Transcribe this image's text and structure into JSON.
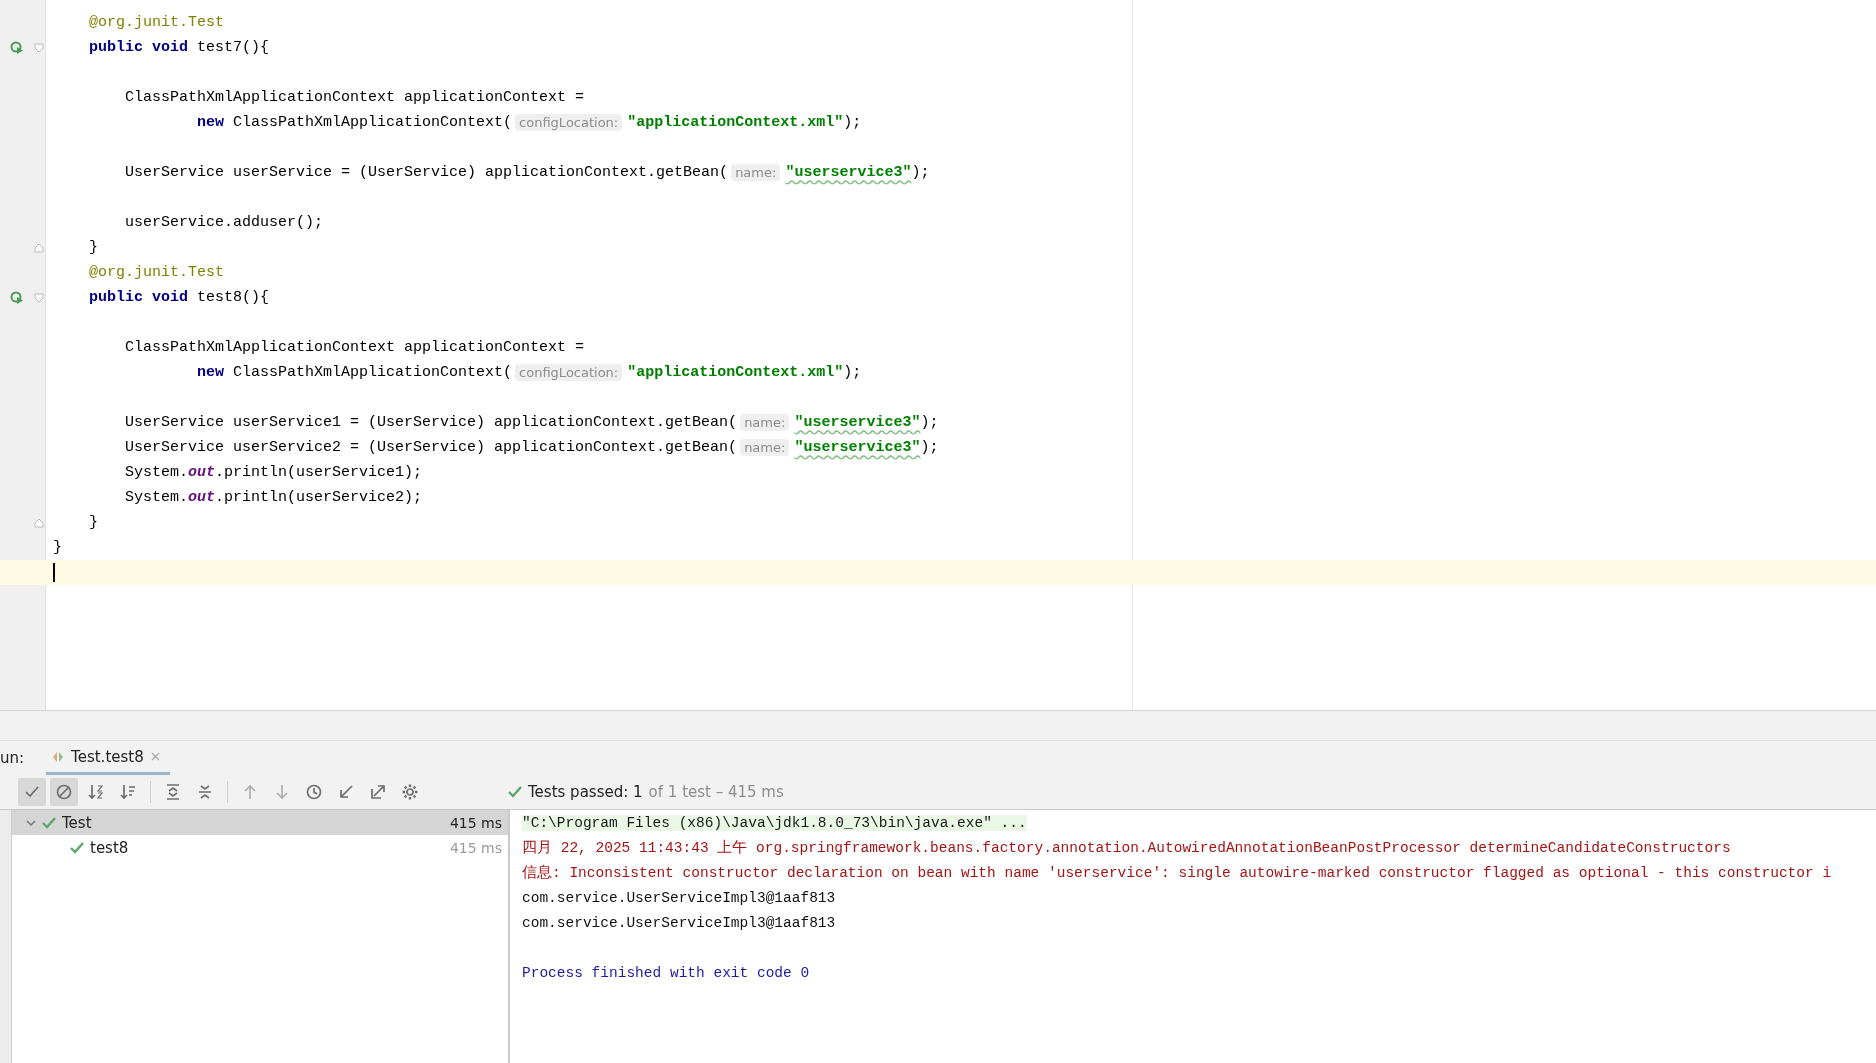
{
  "editor": {
    "lines": [
      {
        "current": false,
        "tokens": [
          {
            "kind": "annotation",
            "text": "    @org.junit."
          },
          {
            "kind": "annotation-name",
            "text": "Test"
          }
        ]
      },
      {
        "current": false,
        "run": true,
        "fold_start": true,
        "tokens": [
          {
            "kind": "keyword",
            "text": "    public void "
          },
          {
            "kind": "plain",
            "text": "test7(){"
          }
        ]
      },
      {
        "current": false
      },
      {
        "current": false,
        "tokens": [
          {
            "kind": "plain",
            "text": "        ClassPathXmlApplicationContext applicationContext ="
          }
        ]
      },
      {
        "current": false,
        "tokens": [
          {
            "kind": "keyword",
            "text": "                new "
          },
          {
            "kind": "plain",
            "text": "ClassPathXmlApplicationContext("
          },
          {
            "kind": "hint",
            "text": "configLocation:"
          },
          {
            "kind": "string",
            "text": "\"applicationContext.xml\""
          },
          {
            "kind": "plain",
            "text": ");"
          }
        ]
      },
      {
        "current": false
      },
      {
        "current": false,
        "tokens": [
          {
            "kind": "plain",
            "text": "        UserService userService = (UserService) applicationContext.getBean("
          },
          {
            "kind": "hint",
            "text": "name:"
          },
          {
            "kind": "string",
            "text": "\"userservice3\"",
            "underlined": true
          },
          {
            "kind": "plain",
            "text": ");"
          }
        ]
      },
      {
        "current": false
      },
      {
        "current": false,
        "tokens": [
          {
            "kind": "plain",
            "text": "        userService.adduser();"
          }
        ]
      },
      {
        "current": false,
        "fold_end": true,
        "tokens": [
          {
            "kind": "plain",
            "text": "    }"
          }
        ]
      },
      {
        "current": false,
        "tokens": [
          {
            "kind": "annotation",
            "text": "    @org.junit."
          },
          {
            "kind": "annotation-name",
            "text": "Test"
          }
        ]
      },
      {
        "current": false,
        "run": true,
        "fold_start": true,
        "tokens": [
          {
            "kind": "keyword",
            "text": "    public void "
          },
          {
            "kind": "plain",
            "text": "test8(){"
          }
        ]
      },
      {
        "current": false
      },
      {
        "current": false,
        "tokens": [
          {
            "kind": "plain",
            "text": "        ClassPathXmlApplicationContext applicationContext ="
          }
        ]
      },
      {
        "current": false,
        "tokens": [
          {
            "kind": "keyword",
            "text": "                new "
          },
          {
            "kind": "plain",
            "text": "ClassPathXmlApplicationContext("
          },
          {
            "kind": "hint",
            "text": "configLocation:"
          },
          {
            "kind": "string",
            "text": "\"applicationContext.xml\""
          },
          {
            "kind": "plain",
            "text": ");"
          }
        ]
      },
      {
        "current": false
      },
      {
        "current": false,
        "tokens": [
          {
            "kind": "plain",
            "text": "        UserService userService1 = (UserService) applicationContext.getBean("
          },
          {
            "kind": "hint",
            "text": "name:"
          },
          {
            "kind": "string",
            "text": "\"userservice3\"",
            "underlined": true
          },
          {
            "kind": "plain",
            "text": ");"
          }
        ]
      },
      {
        "current": false,
        "tokens": [
          {
            "kind": "plain",
            "text": "        UserService userService2 = (UserService) applicationContext.getBean("
          },
          {
            "kind": "hint",
            "text": "name:"
          },
          {
            "kind": "string",
            "text": "\"userservice3\"",
            "underlined": true
          },
          {
            "kind": "plain",
            "text": ");"
          }
        ]
      },
      {
        "current": false,
        "tokens": [
          {
            "kind": "plain",
            "text": "        System."
          },
          {
            "kind": "field",
            "text": "out"
          },
          {
            "kind": "plain",
            "text": ".println(userService1);"
          }
        ]
      },
      {
        "current": false,
        "tokens": [
          {
            "kind": "plain",
            "text": "        System."
          },
          {
            "kind": "field",
            "text": "out"
          },
          {
            "kind": "plain",
            "text": ".println(userService2);"
          }
        ]
      },
      {
        "current": false,
        "fold_end": true,
        "tokens": [
          {
            "kind": "plain",
            "text": "    }"
          }
        ]
      },
      {
        "current": false,
        "tokens": [
          {
            "kind": "plain",
            "text": "}"
          }
        ]
      },
      {
        "current": true
      }
    ]
  },
  "run_panel": {
    "label": "un:",
    "tabs": [
      {
        "label": "Test.test8",
        "selected": true
      }
    ],
    "toolbar": [
      {
        "kind": "check",
        "selected": true
      },
      {
        "kind": "ignored",
        "selected": true
      },
      {
        "kind": "sort-alpha",
        "selected": false
      },
      {
        "kind": "sort-duration",
        "selected": false
      },
      {
        "kind": "sep"
      },
      {
        "kind": "expand",
        "selected": false
      },
      {
        "kind": "collapse",
        "selected": false
      },
      {
        "kind": "sep"
      },
      {
        "kind": "up",
        "selected": false
      },
      {
        "kind": "down",
        "selected": false
      },
      {
        "kind": "history",
        "selected": false
      },
      {
        "kind": "import",
        "selected": false
      },
      {
        "kind": "export",
        "selected": false
      },
      {
        "kind": "gear",
        "selected": false
      }
    ],
    "status": {
      "main": "Tests passed: 1",
      "detail": "of 1 test – 415 ms"
    },
    "tree": [
      {
        "label": "Test",
        "time": "415 ms",
        "expanded": true,
        "selected": true,
        "children": [
          {
            "label": "test8",
            "time": "415 ms",
            "selected": false
          }
        ]
      }
    ],
    "console": [
      {
        "kind": "command",
        "text": "\"C:\\Program Files (x86)\\Java\\jdk1.8.0_73\\bin\\java.exe\" ..."
      },
      {
        "kind": "error",
        "text": "四月 22, 2025 11:43:43 上午 org.springframework.beans.factory.annotation.AutowiredAnnotationBeanPostProcessor determineCandidateConstructors"
      },
      {
        "kind": "error",
        "text": "信息: Inconsistent constructor declaration on bean with name 'userservice': single autowire-marked constructor flagged as optional - this constructor i"
      },
      {
        "kind": "output",
        "text": "com.service.UserServiceImpl3@1aaf813"
      },
      {
        "kind": "output",
        "text": "com.service.UserServiceImpl3@1aaf813"
      },
      {
        "kind": "blank"
      },
      {
        "kind": "exit",
        "text": "Process finished with exit code 0"
      }
    ]
  }
}
